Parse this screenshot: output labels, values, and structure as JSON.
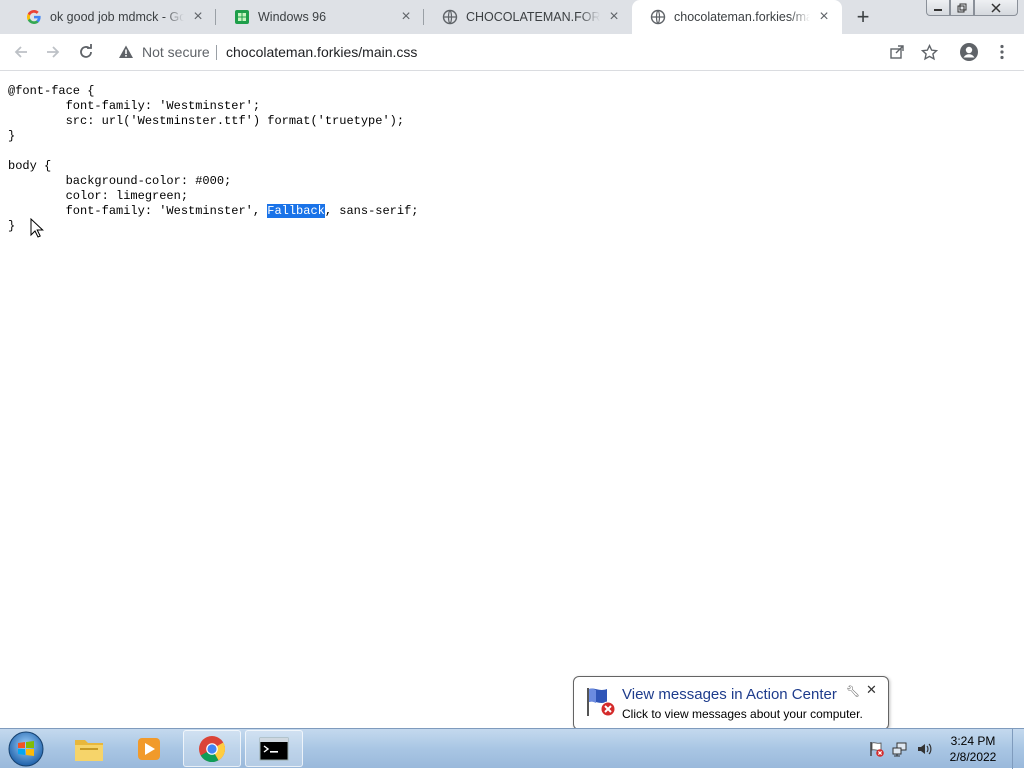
{
  "browser": {
    "tabs": [
      {
        "title": "ok good job mdmck - Goo",
        "icon": "google-g-icon"
      },
      {
        "title": "Windows 96",
        "icon": "windows96-icon"
      },
      {
        "title": "CHOCOLATEMAN.FORKIES",
        "icon": "globe-icon"
      },
      {
        "title": "chocolateman.forkies/main",
        "icon": "globe-icon",
        "active": true
      }
    ],
    "new_tab": "+",
    "security_label": "Not secure",
    "url": "chocolateman.forkies/main.css"
  },
  "code": {
    "before_selection": "@font-face {\n        font-family: 'Westminster';\n        src: url('Westminster.ttf') format('truetype');\n}\n\nbody {\n        background-color: #000;\n        color: limegreen;\n        font-family: 'Westminster', ",
    "selection": "Fallback",
    "after_selection": ", sans-serif;\n}"
  },
  "notification": {
    "title": "View messages in Action Center",
    "text": "Click to view messages about your computer."
  },
  "taskbar": {
    "items": [
      "file-explorer",
      "media-player",
      "chrome",
      "command-prompt"
    ],
    "time": "3:24 PM",
    "date": "2/8/2022"
  },
  "colors": {
    "selection": "#1a73e8",
    "tabstrip": "#dee1e6",
    "balloon_title": "#1e3c8c"
  }
}
